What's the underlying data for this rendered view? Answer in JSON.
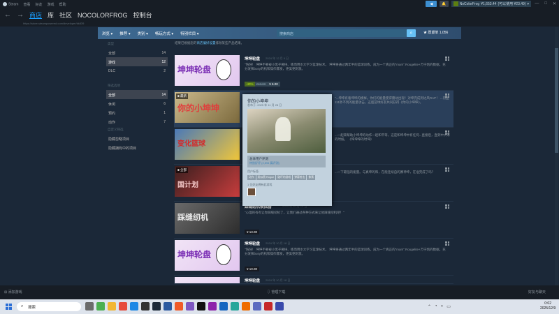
{
  "titlebar": {
    "app_name": "Steam",
    "menus": [
      "查看",
      "好友",
      "游戏",
      "帮助"
    ],
    "balance": "¥1,653.44",
    "balance_note": "(可以使用 ¥23.49)",
    "user": "NoColorFrog",
    "badge_line1": "等级",
    "badge_line2": "428236"
  },
  "nav": {
    "back": "←",
    "forward": "→",
    "tabs": [
      "商店",
      "库",
      "社区",
      "NOCOLORFROG",
      "控制台"
    ],
    "url": "https://store.steampowered.com/developer/kk839"
  },
  "store_nav": {
    "items": [
      "浏览 ▾",
      "推荐 ▾",
      "类别 ▾",
      "畅玩方式 ▾",
      "特别栏目 ▾"
    ],
    "search_placeholder": "搜索商店",
    "search_icon": "search-icon",
    "wishlist": "★ 愿望单 1,056"
  },
  "notice": {
    "prefix": "结果已根据您的",
    "link": "商店偏好设置",
    "suffix": "排除某些产品结果。"
  },
  "sidebar": {
    "type_header": "类型",
    "types": [
      {
        "label": "全部",
        "count": "14"
      },
      {
        "label": "游戏",
        "count": "12"
      },
      {
        "label": "DLC",
        "count": "2"
      }
    ],
    "filter_header": "筛选选项",
    "filters": [
      {
        "label": "全部",
        "count": "14"
      },
      {
        "label": "休闲",
        "count": "6"
      },
      {
        "label": "预约",
        "count": "1"
      },
      {
        "label": "动作",
        "count": "7"
      }
    ],
    "links_header": "自定义筛选",
    "links": [
      "隐藏忽略项目",
      "隐藏拥有中的项目"
    ]
  },
  "games": [
    {
      "title": "坤坤轮盘",
      "date": "2024 年 12 月 9 日",
      "thumb_text": "坤坤轮盘",
      "desc": "\"铛铛！ 坤坤不要被小黑子要挟、练而用水大学习篮球技术。 坤坤将通过两年半的篮球训练，成为一个真正的\"man!\".Rougelite+万宁炮的数据，充分发挥busy的机和操作爆发，更美更刺激。",
      "discount": "-40%",
      "orig": "¥10.00",
      "price": "¥ 6.00"
    },
    {
      "title": "你的小坤坤",
      "date": "",
      "thumb_text": "你的小坤坤",
      "thumb_label": "■ 最新",
      "desc": "\"...坤坤有着坤坤的模样。你们的能量使得震动出现！对坤完成到达风RAP！ ...热血111秒不到的能量攻击，这超篮球好友共同获得《你的小坤坤》。",
      "discount": "",
      "orig": "",
      "price": ""
    },
    {
      "title": "",
      "date": "",
      "thumb_text": "变化篮球",
      "desc": "...一起来帮助小坤坤的动作一起和平等，这是和坤坤中有任何...直接后，直到中大等的时候。 《坤坤坤的时坤》",
      "discount": "",
      "orig": "",
      "price": ""
    },
    {
      "title": "",
      "date": "",
      "thumb_text": "国计划",
      "thumb_label": "■ 全部",
      "desc": "...一下最强的能量。与真坤的和，在能连续自的赛神坤，在准完成了吗？",
      "discount": "",
      "orig": "",
      "price": ""
    },
    {
      "title": "踩缝纫机模拟器",
      "date": "2024 年 10 月 10 日",
      "thumb_text": "踩缝纫机",
      "desc": "\"心理的有有让你踩缝纫机了，让我们通过各种方式来让他踩缝纫机吧！\"",
      "discount": "",
      "orig": "",
      "price": "¥ 13.00"
    },
    {
      "title": "坤坤轮盘",
      "date": "2024 年 10 月 18 日",
      "thumb_text": "坤坤轮盘",
      "desc": "\"铛铛！ 坤坤不要被小黑子要挟、练而用水大学习篮球技术。 坤坤将通过两年半的篮球训练，成为一个真正的\"man!\".Rougelite+万宁炮的数据，充分发挥busy的机和操作爆发，更美更刺激。",
      "discount": "",
      "orig": "",
      "price": "¥ 10.00"
    },
    {
      "title": "坤坤轮盘",
      "date": "2024 年 10 月 18 日",
      "thumb_text": "",
      "desc": "",
      "discount": "",
      "orig": "",
      "price": ""
    }
  ],
  "popup": {
    "title": "你的小坤坤",
    "date": "发布于: 2025 年 11 月 28 日",
    "review_header": "总体用户评测",
    "review_value": "特别好评 (2,594 篇评测)",
    "tags_header": "用户标签:",
    "tags": [
      "动作",
      "类似黑 Rogue",
      "破坏的游戏",
      "弹幕射击",
      "像素"
    ],
    "friends_header": "1 位好友拥有此游戏"
  },
  "bottom_bar": {
    "add_game": "添加游戏",
    "downloads": "管理下载",
    "friends": "好友与聊天"
  },
  "taskbar": {
    "search": "搜索",
    "time": "0:02",
    "date": "2025/12/9"
  }
}
